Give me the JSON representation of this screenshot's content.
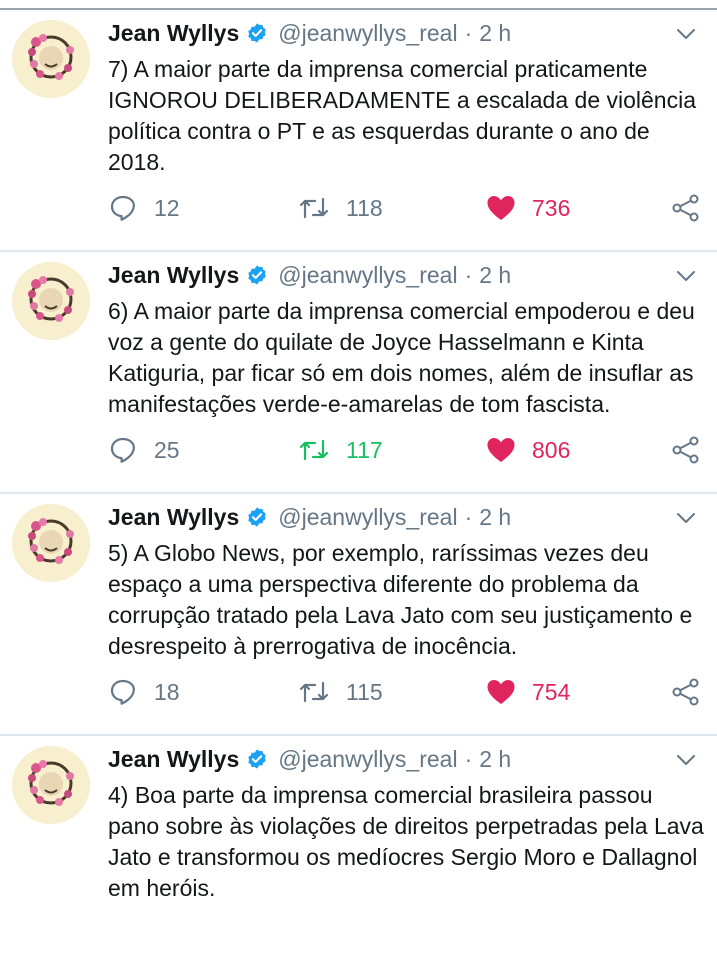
{
  "tweets": [
    {
      "name": "Jean Wyllys",
      "handle": "@jeanwyllys_real",
      "separator": "·",
      "time": "2 h",
      "text": "7) A maior parte da imprensa comercial praticamente IGNOROU DELIBERADAMENTE a escalada de violência política contra o PT e as esquerdas durante o ano de 2018.",
      "replies": "12",
      "retweets": "118",
      "likes": "736",
      "retweeted": false
    },
    {
      "name": "Jean Wyllys",
      "handle": "@jeanwyllys_real",
      "separator": "·",
      "time": "2 h",
      "text": "6) A maior parte da imprensa comercial empoderou e deu voz a gente do quilate de Joyce Hasselmann e Kinta Katiguria, par ficar só em dois nomes, além de insuflar as manifestações verde-e-amarelas de tom fascista.",
      "replies": "25",
      "retweets": "117",
      "likes": "806",
      "retweeted": true
    },
    {
      "name": "Jean Wyllys",
      "handle": "@jeanwyllys_real",
      "separator": "·",
      "time": "2 h",
      "text": "5) A Globo News, por exemplo, raríssimas vezes deu espaço a uma perspectiva diferente do problema da corrupção tratado pela Lava Jato com seu justiçamento e desrespeito à prerrogativa de inocência.",
      "replies": "18",
      "retweets": "115",
      "likes": "754",
      "retweeted": false
    },
    {
      "name": "Jean Wyllys",
      "handle": "@jeanwyllys_real",
      "separator": "·",
      "time": "2 h",
      "text": "4) Boa parte da imprensa comercial brasileira passou pano sobre às violações de direitos perpetradas pela Lava Jato e transformou os medíocres Sergio Moro e Dallagnol em heróis.",
      "replies": "",
      "retweets": "",
      "likes": "",
      "retweeted": false
    }
  ],
  "colors": {
    "verified": "#1da1f2",
    "gray": "#657786",
    "retweet_active": "#17bf63",
    "like": "#e0245e"
  },
  "icons": [
    "verified-icon",
    "chevron-down-icon",
    "reply-icon",
    "retweet-icon",
    "like-icon",
    "share-icon"
  ]
}
